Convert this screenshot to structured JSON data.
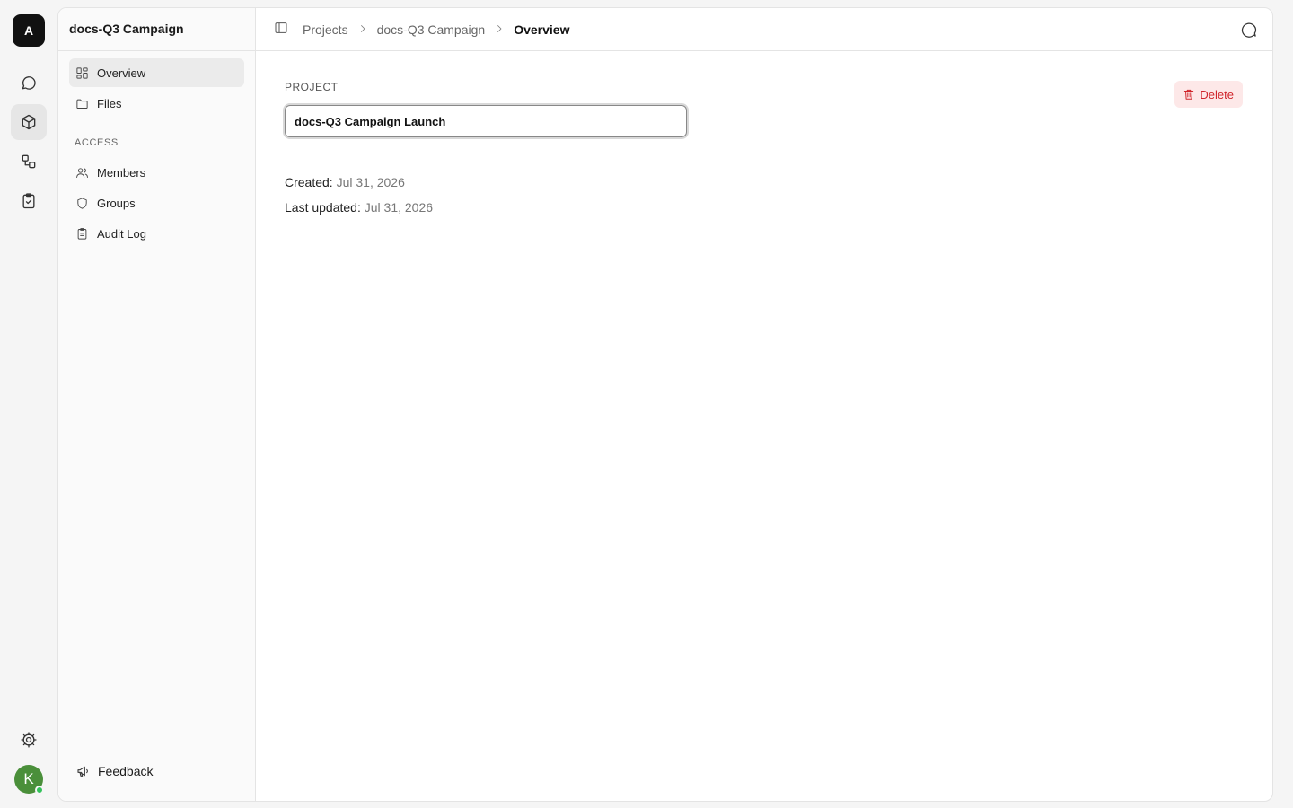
{
  "rail": {
    "logo_letter": "A",
    "items": [
      {
        "icon": "chat-icon"
      },
      {
        "icon": "cube-icon",
        "active": true
      },
      {
        "icon": "workflow-icon"
      },
      {
        "icon": "clipboard-check-icon"
      }
    ],
    "settings_icon": "gear-icon",
    "avatar_letter": "K",
    "avatar_color": "#4a8f3a",
    "status_color": "#33c25a"
  },
  "sidebar": {
    "project_title": "docs-Q3 Campaign",
    "items": [
      {
        "label": "Overview",
        "icon": "dashboard-icon",
        "active": true
      },
      {
        "label": "Files",
        "icon": "folder-icon"
      }
    ],
    "access_section_label": "ACCESS",
    "access_items": [
      {
        "label": "Members",
        "icon": "users-icon"
      },
      {
        "label": "Groups",
        "icon": "shield-icon"
      },
      {
        "label": "Audit Log",
        "icon": "clipboard-list-icon"
      }
    ],
    "feedback_label": "Feedback"
  },
  "topbar": {
    "breadcrumbs": [
      "Projects",
      "docs-Q3 Campaign",
      "Overview"
    ]
  },
  "main": {
    "field_label": "PROJECT",
    "project_name_value": "docs-Q3 Campaign Launch",
    "delete_label": "Delete",
    "delete_color": "#d0252b",
    "created_label": "Created:",
    "created_value": "Jul 31, 2026",
    "updated_label": "Last updated:",
    "updated_value": "Jul 31, 2026"
  }
}
